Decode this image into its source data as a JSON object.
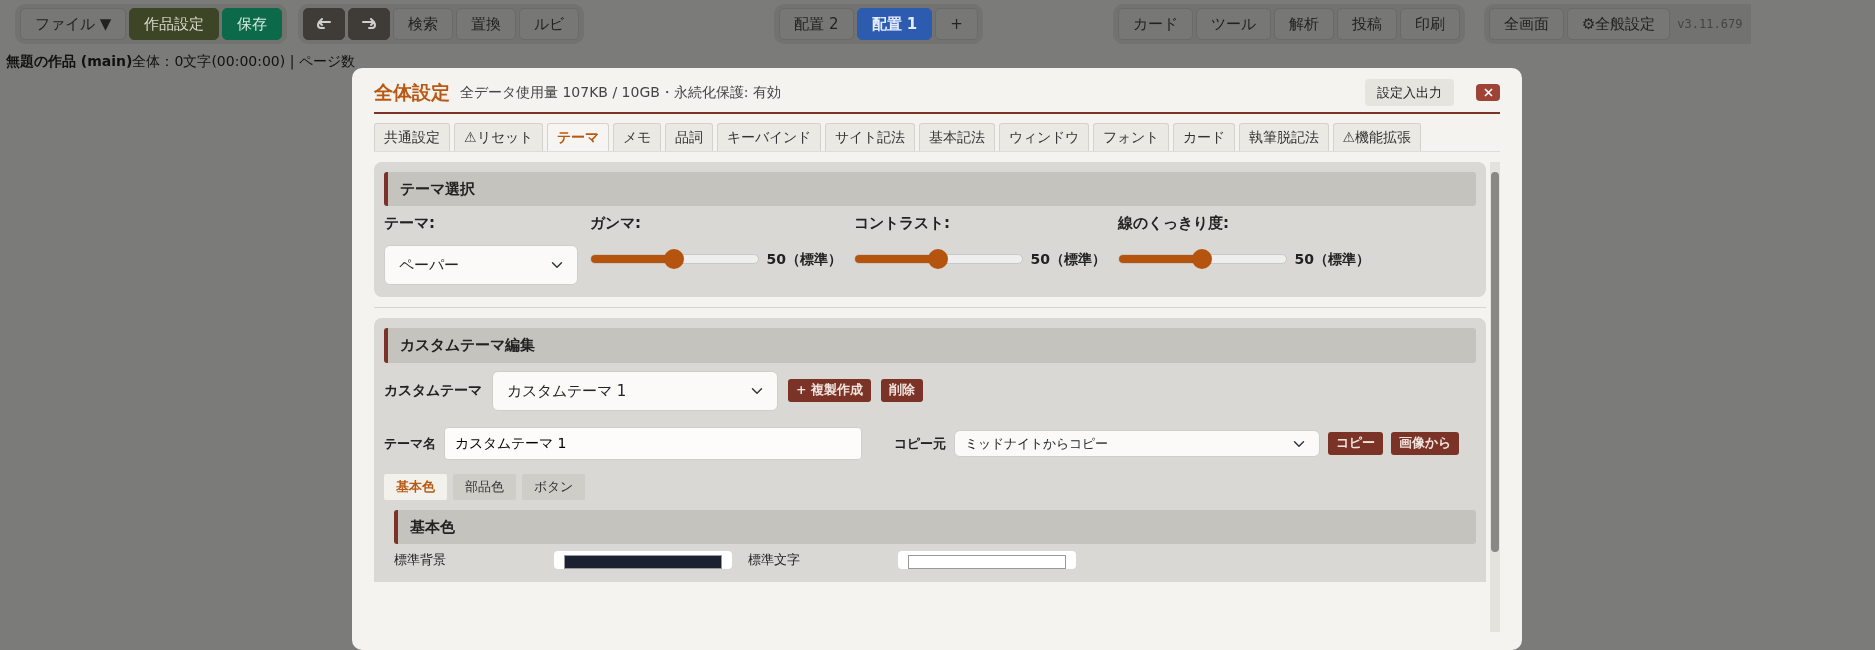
{
  "toolbar": {
    "file_group": [
      {
        "label": "ファイル",
        "caret": "▼",
        "kind": "menu"
      },
      {
        "label": "作品設定",
        "kind": "olive"
      },
      {
        "label": "保存",
        "kind": "green"
      }
    ],
    "edit_group": [
      {
        "kind": "undo"
      },
      {
        "kind": "redo"
      },
      {
        "label": "検索",
        "kind": "plain"
      },
      {
        "label": "置換",
        "kind": "plain"
      },
      {
        "label": "ルビ",
        "kind": "plain"
      }
    ],
    "layout_tabs": [
      {
        "label": "配置 2",
        "selected": false
      },
      {
        "label": "配置 1",
        "selected": true
      }
    ],
    "add_layout": "+",
    "tool_group": [
      "カード",
      "ツール",
      "解析",
      "投稿",
      "印刷"
    ],
    "view_group": [
      "全画面",
      "⚙全般設定"
    ],
    "version": "v3.11.679"
  },
  "status_line": {
    "title": "無題の作品 (main)",
    "stats": "全体：0文字(00:00:00) | ページ数"
  },
  "dialog": {
    "title": "全体設定",
    "usage": "全データ使用量 107KB / 10GB・永続化保護: 有効",
    "io_button": "設定入出力",
    "tabs": [
      {
        "label": "共通設定",
        "selected": false
      },
      {
        "label": "⚠リセット",
        "selected": false
      },
      {
        "label": "テーマ",
        "selected": true
      },
      {
        "label": "メモ",
        "selected": false
      },
      {
        "label": "品詞",
        "selected": false
      },
      {
        "label": "キーバインド",
        "selected": false
      },
      {
        "label": "サイト記法",
        "selected": false
      },
      {
        "label": "基本記法",
        "selected": false
      },
      {
        "label": "ウィンドウ",
        "selected": false
      },
      {
        "label": "フォント",
        "selected": false
      },
      {
        "label": "カード",
        "selected": false
      },
      {
        "label": "執筆脱記法",
        "selected": false
      },
      {
        "label": "⚠機能拡張",
        "selected": false
      }
    ],
    "theme_select": {
      "title": "テーマ選択",
      "theme_label": "テーマ:",
      "theme_value": "ペーパー",
      "sliders": [
        {
          "label": "ガンマ:",
          "level": 0.5,
          "reading": "50（標準）"
        },
        {
          "label": "コントラスト:",
          "level": 0.5,
          "reading": "50（標準）"
        },
        {
          "label": "線のくっきり度:",
          "level": 0.5,
          "reading": "50（標準）"
        }
      ]
    },
    "custom_theme": {
      "title": "カスタムテーマ編集",
      "custom_label": "カスタムテーマ",
      "custom_value": "カスタムテーマ 1",
      "custom_buttons": [
        "+ 複製作成",
        "削除"
      ],
      "name_label": "テーマ名",
      "name_value": "カスタムテーマ 1",
      "copy_label": "コピー元",
      "copy_value": "ミッドナイトからコピー",
      "copy_buttons": [
        "コピー",
        "画像から"
      ],
      "subtabs": [
        {
          "label": "基本色",
          "selected": true
        },
        {
          "label": "部品色",
          "selected": false
        },
        {
          "label": "ボタン",
          "selected": false
        }
      ],
      "basic": {
        "title": "基本色",
        "rows": [
          {
            "label": "標準背景",
            "color": "#1b2130"
          },
          {
            "label": "標準文字",
            "color": "#ffffff"
          }
        ]
      }
    }
  }
}
